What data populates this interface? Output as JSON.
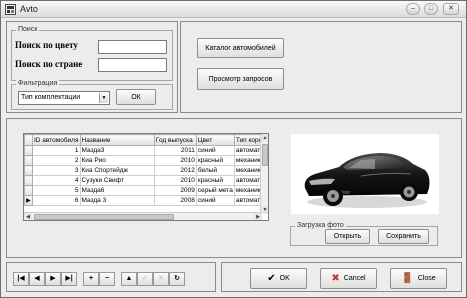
{
  "window": {
    "title": "Avto",
    "controls": {
      "minimize": "–",
      "maximize": "□",
      "close": "✕"
    }
  },
  "search": {
    "group_title": "Поиск",
    "by_color_label": "Поиск по цвету",
    "by_color_value": "",
    "by_country_label": "Поиск по стране",
    "by_country_value": ""
  },
  "filter": {
    "group_title": "Фильтрация",
    "selected": "Тип комплектации",
    "ok_label": "ОК"
  },
  "actions": {
    "catalog_label": "Каталог автомобилей",
    "queries_label": "Просмотр запросов"
  },
  "grid": {
    "columns": [
      "ID автомобиля",
      "Название",
      "Год выпуска",
      "Цвет",
      "Тип короб"
    ],
    "rows": [
      {
        "indicator": "",
        "id": "1",
        "name": "Мазда3",
        "year": "2011",
        "color": "синий",
        "gearbox": "автомат"
      },
      {
        "indicator": "",
        "id": "2",
        "name": "Киа Рио",
        "year": "2010",
        "color": "красный",
        "gearbox": "механика"
      },
      {
        "indicator": "",
        "id": "3",
        "name": "Киа Спортейдж",
        "year": "2012",
        "color": "белый",
        "gearbox": "механика"
      },
      {
        "indicator": "",
        "id": "4",
        "name": "Сузуки Свифт",
        "year": "2010",
        "color": "красный",
        "gearbox": "автомат"
      },
      {
        "indicator": "",
        "id": "5",
        "name": "Мазда6",
        "year": "2009",
        "color": "серый мета",
        "gearbox": "механика"
      },
      {
        "indicator": "▶",
        "id": "6",
        "name": "Мазда 3",
        "year": "2008",
        "color": "синий",
        "gearbox": "автомат"
      }
    ]
  },
  "photo": {
    "group_title": "Загрузка фото",
    "open_label": "Открыть",
    "save_label": "Сохранить"
  },
  "navigator": {
    "buttons": [
      {
        "name": "nav-first",
        "glyph": "|◀",
        "enabled": true
      },
      {
        "name": "nav-prior",
        "glyph": "◀",
        "enabled": true
      },
      {
        "name": "nav-next",
        "glyph": "▶",
        "enabled": true
      },
      {
        "name": "nav-last",
        "glyph": "▶|",
        "enabled": true
      },
      {
        "name": "nav-insert",
        "glyph": "+",
        "enabled": true
      },
      {
        "name": "nav-delete",
        "glyph": "−",
        "enabled": true
      },
      {
        "name": "nav-edit",
        "glyph": "▲",
        "enabled": true
      },
      {
        "name": "nav-post",
        "glyph": "✓",
        "enabled": false
      },
      {
        "name": "nav-cancel",
        "glyph": "✕",
        "enabled": false
      },
      {
        "name": "nav-refresh",
        "glyph": "↻",
        "enabled": true
      }
    ]
  },
  "dialog": {
    "ok_label": "OK",
    "cancel_label": "Cancel",
    "close_label": "Close",
    "ok_color": "#1a1a1a",
    "cancel_color": "#c0392b"
  }
}
